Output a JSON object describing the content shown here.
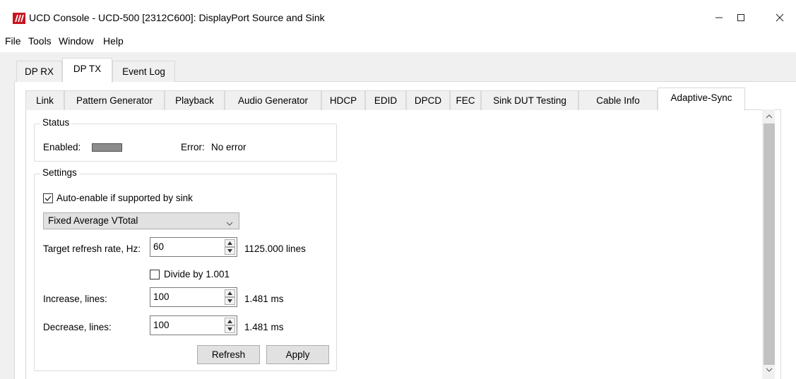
{
  "window": {
    "title": "UCD Console - UCD-500 [2312C600]: DisplayPort Source and Sink",
    "icon": "ucd-logo-icon",
    "controls": [
      "minimize-icon",
      "maximize-icon",
      "close-icon"
    ]
  },
  "menu": {
    "file": "File",
    "tools": "Tools",
    "window": "Window",
    "help": "Help"
  },
  "top_tabs": {
    "dp_rx": "DP RX",
    "dp_tx": "DP TX",
    "event_log": "Event Log",
    "active": "DP TX"
  },
  "sub_tabs": {
    "link": "Link",
    "pattern_generator": "Pattern Generator",
    "playback": "Playback",
    "audio_generator": "Audio Generator",
    "hdcp": "HDCP",
    "edid": "EDID",
    "dpcd": "DPCD",
    "fec": "FEC",
    "sink_dut_testing": "Sink DUT Testing",
    "cable_info": "Cable Info",
    "adaptive_sync": "Adaptive-Sync",
    "active": "Adaptive-Sync"
  },
  "status": {
    "group_label": "Status",
    "enabled_label": "Enabled:",
    "enabled_indicator_color": "#8c8c8c",
    "error_label": "Error:",
    "error_value": "No error"
  },
  "settings": {
    "group_label": "Settings",
    "auto_enable_label": "Auto-enable if supported by sink",
    "auto_enable_checked": true,
    "mode_selected": "Fixed Average VTotal",
    "target_refresh_label": "Target refresh rate, Hz:",
    "target_refresh_value": "60",
    "target_refresh_info": "1125.000 lines",
    "divide_label": "Divide by 1.001",
    "divide_checked": false,
    "increase_label": "Increase, lines:",
    "increase_value": "100",
    "increase_info": "1.481 ms",
    "decrease_label": "Decrease, lines:",
    "decrease_value": "100",
    "decrease_info": "1.481 ms",
    "refresh_button": "Refresh",
    "apply_button": "Apply"
  }
}
